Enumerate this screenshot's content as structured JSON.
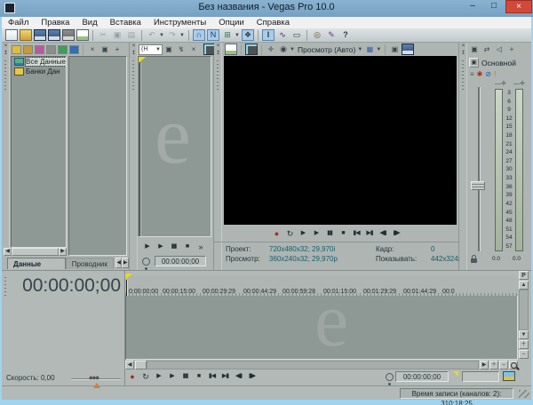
{
  "window": {
    "title": "Без названия - Vegas Pro 10.0",
    "buttons": {
      "minimize": "–",
      "maximize": "□",
      "close": "×"
    }
  },
  "menu": {
    "items": [
      "Файл",
      "Правка",
      "Вид",
      "Вставка",
      "Инструменты",
      "Опции",
      "Справка"
    ]
  },
  "main_toolbar": {
    "icons": [
      {
        "name": "new-project",
        "glyph": ""
      },
      {
        "name": "open-project",
        "glyph": ""
      },
      {
        "name": "save-project",
        "glyph": ""
      },
      {
        "name": "render-as",
        "glyph": ""
      },
      {
        "name": "publish-project",
        "glyph": ""
      },
      {
        "name": "project-properties",
        "glyph": ""
      },
      {
        "name": "cut",
        "glyph": "✂"
      },
      {
        "name": "copy",
        "glyph": "▣"
      },
      {
        "name": "paste",
        "glyph": "▤"
      },
      {
        "name": "undo",
        "glyph": "↶"
      },
      {
        "name": "redo",
        "glyph": "↷"
      },
      {
        "name": "enable-snapping",
        "glyph": "∩"
      },
      {
        "name": "auto-ripple",
        "glyph": "N"
      },
      {
        "name": "lock-envelopes",
        "glyph": "⊞"
      },
      {
        "name": "ignore-event-grouping",
        "glyph": "❖"
      },
      {
        "name": "normal-edit-tool",
        "glyph": "I"
      },
      {
        "name": "envelope-edit-tool",
        "glyph": "∿"
      },
      {
        "name": "selection-edit-tool",
        "glyph": "▭"
      },
      {
        "name": "zoom-edit-tool",
        "glyph": "◎"
      },
      {
        "name": "interactive-tutorials",
        "glyph": "✎"
      },
      {
        "name": "whats-this-help",
        "glyph": "?"
      }
    ]
  },
  "project_media": {
    "tree": [
      {
        "label": "Все Данные"
      },
      {
        "label": "Банки Дан"
      }
    ],
    "tabs": {
      "active": "Данные проекта",
      "inactive": "Проводник"
    }
  },
  "trimmer": {
    "history_combo": "(H",
    "overflow": "»",
    "timecode": "00:00:00;00"
  },
  "preview": {
    "mode": "Просмотр (Авто)",
    "info": {
      "project_label": "Проект:",
      "project_value": "720x480x32; 29,970i",
      "preview_label": "Просмотр:",
      "preview_value": "360x240x32; 29,970p",
      "frame_label": "Кадр:",
      "frame_value": "0",
      "display_label": "Показывать:",
      "display_value": "442x324x32"
    }
  },
  "transport": [
    {
      "name": "record",
      "glyph": "●"
    },
    {
      "name": "loop-playback",
      "glyph": "↻"
    },
    {
      "name": "play-from-start",
      "glyph": "▶"
    },
    {
      "name": "play",
      "glyph": "▶"
    },
    {
      "name": "pause",
      "glyph": "▮▮"
    },
    {
      "name": "stop",
      "glyph": "■"
    },
    {
      "name": "go-to-start",
      "glyph": "▮◀"
    },
    {
      "name": "go-to-end",
      "glyph": "▶▮"
    },
    {
      "name": "previous-frame",
      "glyph": "◀▮"
    },
    {
      "name": "next-frame",
      "glyph": "▮▶"
    }
  ],
  "mixer": {
    "bus": "Основной",
    "scale": [
      "3",
      "6",
      "9",
      "12",
      "15",
      "18",
      "21",
      "24",
      "27",
      "30",
      "33",
      "36",
      "39",
      "42",
      "45",
      "48",
      "51",
      "54",
      "57"
    ],
    "meter_left": "0.0",
    "meter_right": "0.0"
  },
  "timeline": {
    "big_timecode": "00:00:00;00",
    "ruler_labels": [
      "0:00:00:00",
      "00:00:15:00",
      "00:00:29:29",
      "00:00:44:29",
      "00:00:59:28",
      "00:01:15:00",
      "00:01:29:29",
      "00:01:44:29",
      "00:0"
    ],
    "rate": "Скорость: 0,00",
    "cursor_timecode": "00:00:00;00",
    "panel_button": "P",
    "status": "Время записи (каналов: 2): 310:18:25"
  },
  "watermark": "e"
}
